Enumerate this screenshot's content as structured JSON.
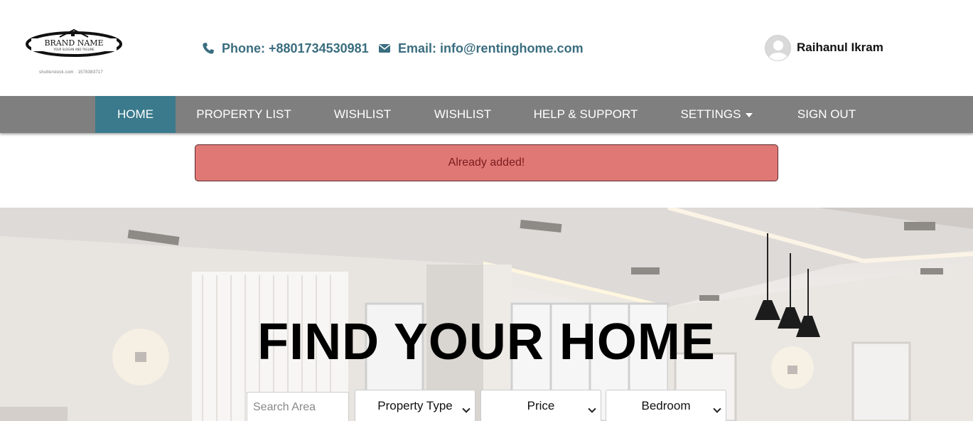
{
  "brand": {
    "name": "BRAND NAME",
    "tagline": "YOUR SLOGAN AND TAGLINE",
    "caption": "shutterstock.com · 1578383717"
  },
  "header": {
    "phone": "Phone: +8801734530981",
    "email": "Email: info@rentinghome.com",
    "user_name": "Raihanul Ikram",
    "accent_color": "#3a6d7f"
  },
  "nav": {
    "active_color": "#3a7a8c",
    "bar_color": "#7f7f7f",
    "items": [
      {
        "label": "HOME"
      },
      {
        "label": "PROPERTY LIST"
      },
      {
        "label": "WISHLIST"
      },
      {
        "label": "WISHLIST"
      },
      {
        "label": "HELP & SUPPORT"
      },
      {
        "label": "SETTINGS"
      },
      {
        "label": "SIGN OUT"
      }
    ]
  },
  "alert": {
    "message": "Already added!",
    "color": "#e07876"
  },
  "hero": {
    "title": "FIND YOUR HOME",
    "search": {
      "placeholder": "Search Area",
      "value": ""
    },
    "filters": {
      "property_type": "Property Type",
      "price": "Price",
      "bedroom": "Bedroom"
    }
  }
}
